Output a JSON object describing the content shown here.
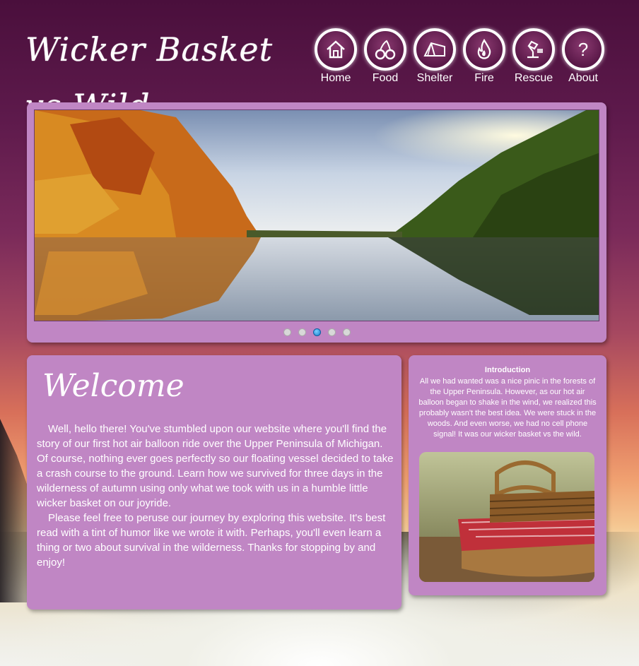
{
  "site": {
    "logo_text": "Wicker Basket vs Wild"
  },
  "nav": {
    "items": [
      {
        "label": "Home",
        "icon": "home-icon"
      },
      {
        "label": "Food",
        "icon": "cherries-icon"
      },
      {
        "label": "Shelter",
        "icon": "tent-icon"
      },
      {
        "label": "Fire",
        "icon": "flame-icon"
      },
      {
        "label": "Rescue",
        "icon": "lamp-icon"
      },
      {
        "label": "About",
        "icon": "question-icon"
      }
    ]
  },
  "slider": {
    "image": "autumn lake landscape",
    "slide_count": 5,
    "active_slide": 3
  },
  "welcome": {
    "title": "Welcome",
    "paragraphs": [
      "Well, hello there! You've stumbled upon our website where you'll find the story of our first hot air balloon ride over the Upper Peninsula of Michigan. Of course, nothing ever goes perfectly so our floating vessel decided to take a crash course to the ground. Learn how we survived for three days in the wilderness of autumn using only what we took with us in a humble little wicker basket on our joyride.",
      "Please feel free to peruse our journey by exploring this website. It's best read with a tint of humor like we wrote it with. Perhaps, you'll even learn a thing or two about survival in the wilderness. Thanks for stopping by and enjoy!"
    ]
  },
  "intro": {
    "title": "Introduction",
    "text": "All we had wanted was a nice pinic in the forests of the Upper Peninsula. However, as our hot air balloon began to shake in the wind, we realized this probably wasn't the best idea. We were stuck in the woods. And even worse, we had no cell phone signal! It was our wicker basket vs the wild.",
    "image": "picnic basket"
  },
  "colors": {
    "panel": "#c086c4",
    "dot_active": "#1a7ccc"
  }
}
